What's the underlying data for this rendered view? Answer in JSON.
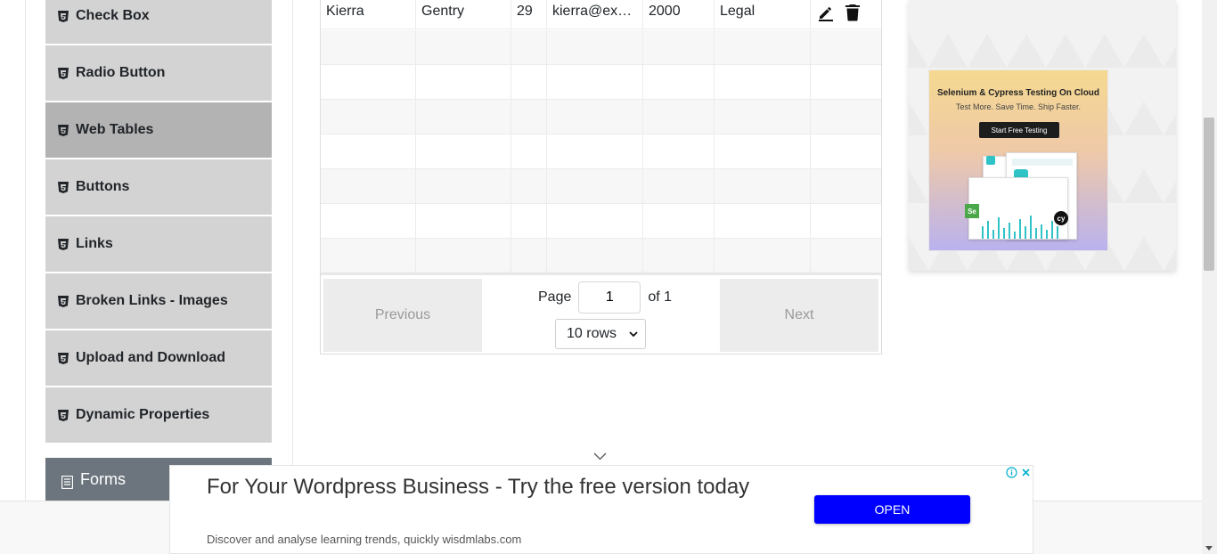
{
  "sidebar": {
    "items": [
      {
        "label": "Check Box",
        "active": false
      },
      {
        "label": "Radio Button",
        "active": false
      },
      {
        "label": "Web Tables",
        "active": true
      },
      {
        "label": "Buttons",
        "active": false
      },
      {
        "label": "Links",
        "active": false
      },
      {
        "label": "Broken Links - Images",
        "active": false
      },
      {
        "label": "Upload and Download",
        "active": false
      },
      {
        "label": "Dynamic Properties",
        "active": false
      }
    ],
    "group": {
      "label": "Forms"
    }
  },
  "table": {
    "rows": [
      {
        "first_name": "Kierra",
        "last_name": "Gentry",
        "age": "29",
        "email": "kierra@example.com",
        "salary": "2000",
        "department": "Legal"
      }
    ],
    "empty_rows": 7
  },
  "pagination": {
    "previous_label": "Previous",
    "next_label": "Next",
    "page_label": "Page",
    "current_page": "1",
    "of_label": "of 1",
    "rows_option": "10 rows"
  },
  "right_ad": {
    "title": "Selenium & Cypress Testing On Cloud",
    "subtitle": "Test More. Save Time. Ship Faster.",
    "cta": "Start Free Testing",
    "badge_se": "Se",
    "badge_cy": "cy"
  },
  "bottom_ad": {
    "headline": "For Your Wordpress Business - Try the free version today",
    "description": "Discover and analyse learning trends, quickly wisdmlabs.com",
    "open_label": "OPEN"
  },
  "colors": {
    "menu_bg": "#d3d3d3",
    "menu_active_bg": "#b3b3b3",
    "group_bg": "#6c757d",
    "open_button": "#0000ff"
  }
}
